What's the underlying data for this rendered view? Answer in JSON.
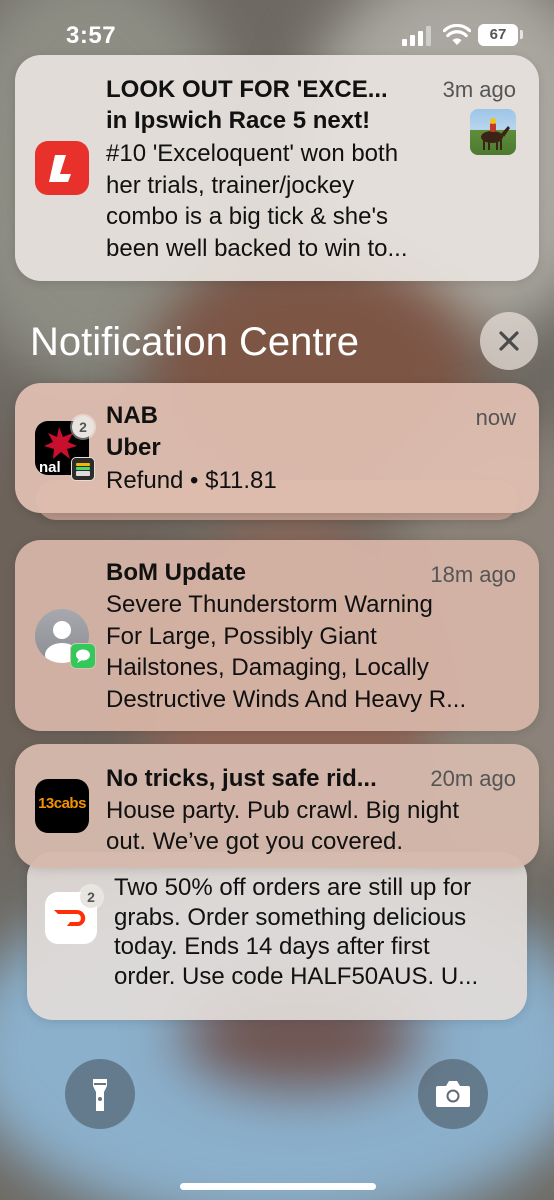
{
  "status_bar": {
    "time": "3:57",
    "battery": "67"
  },
  "pinned_notification": {
    "title": "LOOK OUT FOR 'EXCE...",
    "subtitle": "in Ipswich Race 5 next!",
    "time": "3m ago",
    "body": [
      "#10 'Exceloquent' won both",
      "her trials, trainer/jockey",
      "combo is a big tick & she's",
      "been well backed to win to..."
    ],
    "app_icon": "ladbrokes-icon",
    "thumbnail": "horse-racing-thumbnail"
  },
  "notification_centre": {
    "title": "Notification Centre",
    "close_icon": "close-icon"
  },
  "notifications": [
    {
      "app": "NAB",
      "title": "Uber",
      "time": "now",
      "body": [
        "Refund • $11.81"
      ],
      "badge": "2",
      "app_icon": "nab-icon",
      "sub_icon": "wallet-icon"
    },
    {
      "title": "BoM Update",
      "time": "18m ago",
      "body": [
        "Severe Thunderstorm Warning",
        "For Large, Possibly Giant",
        "Hailstones, Damaging, Locally",
        "Destructive Winds And Heavy R..."
      ],
      "app_icon": "contact-icon",
      "sub_icon": "messages-icon"
    },
    {
      "title": "No tricks, just safe rid...",
      "time": "20m ago",
      "body": [
        "House party. Pub crawl. Big night",
        "out. We’ve got you covered."
      ],
      "app_icon": "13cabs-icon",
      "icon_text": "13cabs"
    },
    {
      "title": "",
      "time": "",
      "body": [
        "Two 50% off orders are still up for",
        "grabs. Order something delicious",
        "today. Ends 14 days after first",
        "order. Use code HALF50AUS. U..."
      ],
      "badge": "2",
      "app_icon": "doordash-icon"
    }
  ],
  "bottom_controls": {
    "left": "flashlight-icon",
    "right": "camera-icon"
  },
  "colors": {
    "ladbrokes": "#e8312a",
    "nab": "#c8102e",
    "thirteen_cabs": "#f39200",
    "doordash": "#ff3008",
    "messages": "#34c759"
  }
}
